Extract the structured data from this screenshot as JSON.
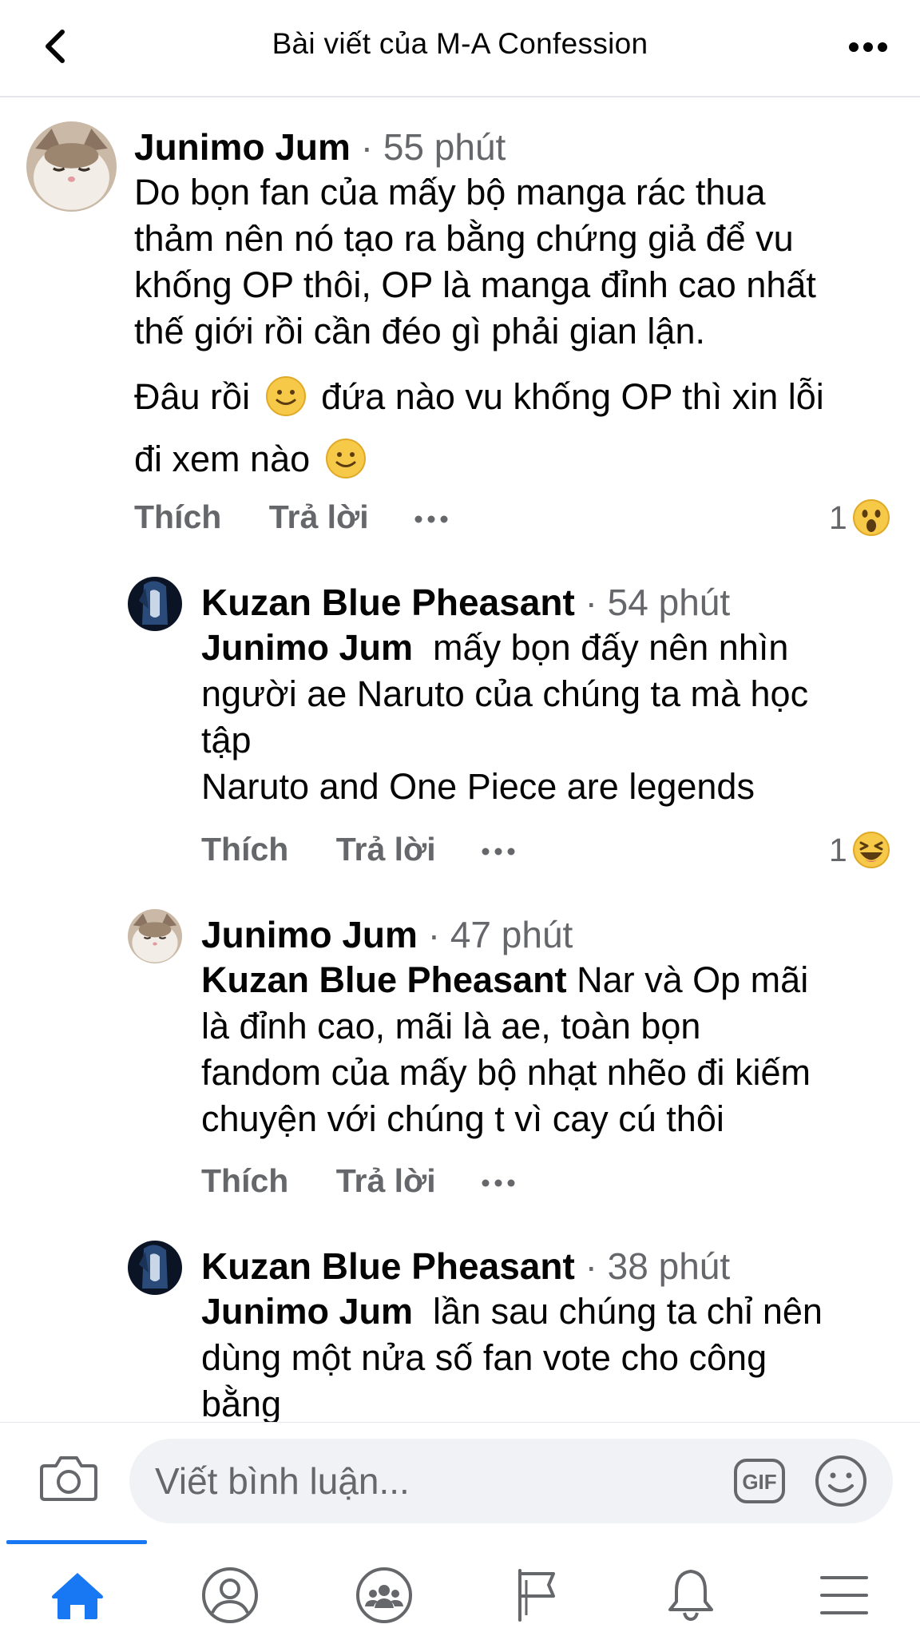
{
  "header": {
    "title": "Bài viết của M-A Confession"
  },
  "comments": [
    {
      "author": "Junimo Jum",
      "time": "55 phút",
      "lines": [
        "Do bọn fan của mấy bộ manga rác thua",
        "thảm nên nó tạo ra bằng chứng giả để vu",
        "khống OP thôi, OP là manga đỉnh cao nhất",
        "thế giới rồi cần đéo gì phải gian lận."
      ],
      "line5_a": "Đâu rồi",
      "line5_b": "đứa nào vu khống OP thì xin lỗi",
      "line6_a": "đi xem nào",
      "like": "Thích",
      "reply": "Trả lời",
      "reaction_count": "1",
      "reaction": "wow"
    },
    {
      "author": "Kuzan Blue Pheasant",
      "time": "54 phút",
      "mention": "Junimo Jum",
      "first_rest": "  mấy bọn đấy nên nhìn",
      "lines": [
        "người ae Naruto của chúng ta mà học",
        "tập",
        "Naruto and One Piece are legends"
      ],
      "like": "Thích",
      "reply": "Trả lời",
      "reaction_count": "1",
      "reaction": "haha"
    },
    {
      "author": "Junimo Jum",
      "time": "47 phút",
      "mention": "Kuzan Blue Pheasant",
      "first_rest": " Nar và Op mãi",
      "lines": [
        "là đỉnh cao, mãi là ae, toàn bọn",
        "fandom của mấy bộ nhạt nhẽo đi kiếm",
        "chuyện với chúng t vì cay cú thôi"
      ],
      "like": "Thích",
      "reply": "Trả lời"
    },
    {
      "author": "Kuzan Blue Pheasant",
      "time": "38 phút",
      "mention": "Junimo Jum",
      "first_rest": "  lần sau chúng ta chỉ nên",
      "lines": [
        "dùng một nửa số fan vote cho công",
        "bằng"
      ]
    }
  ],
  "separator": "·",
  "composer": {
    "placeholder": "Viết bình luận...",
    "gif_label": "GIF"
  },
  "bottom_nav": {
    "active": "home",
    "items": [
      "home-icon",
      "profile-icon",
      "groups-icon",
      "pages-flag-icon",
      "notifications-bell-icon",
      "menu-icon"
    ]
  },
  "colors": {
    "accent": "#1877f2",
    "secondary_text": "#65676b",
    "composer_bg": "#f0f2f5"
  }
}
